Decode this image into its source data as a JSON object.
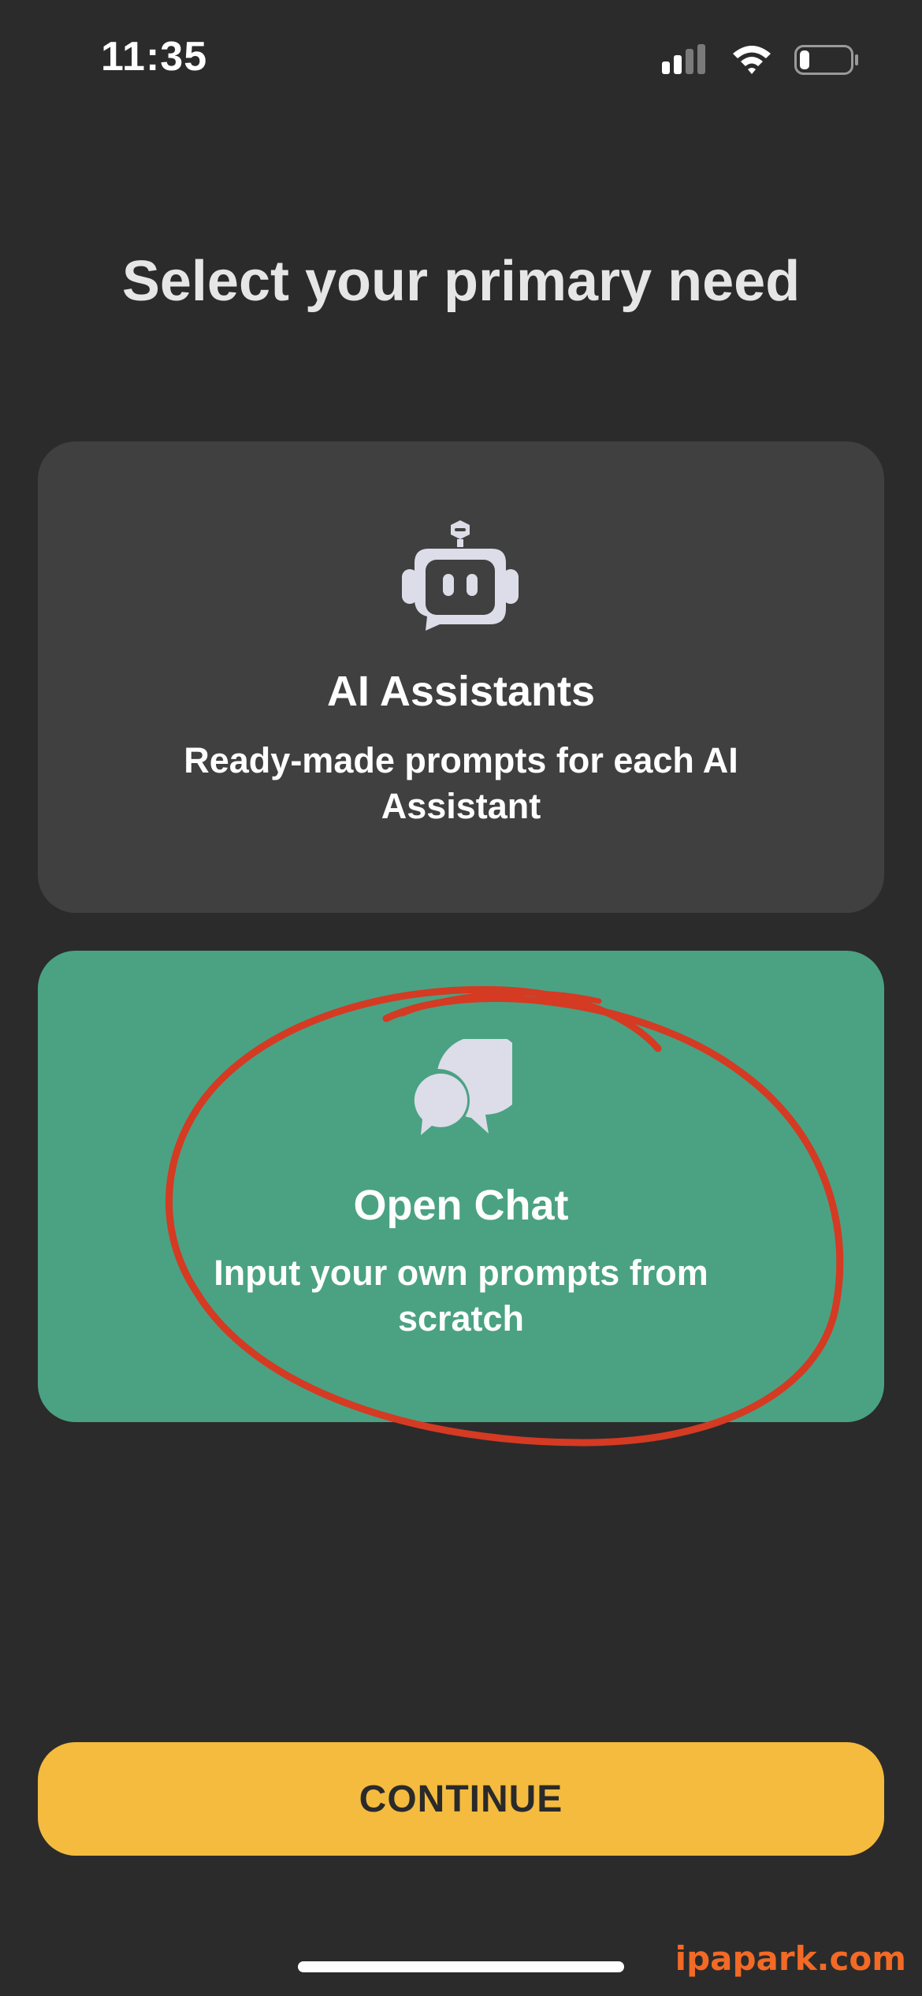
{
  "status_bar": {
    "time": "11:35",
    "icons": [
      "cellular-signal-icon",
      "wifi-icon",
      "battery-icon"
    ],
    "battery_level": 0.2
  },
  "title": "Select your primary need",
  "options": [
    {
      "icon": "robot-icon",
      "title": "AI Assistants",
      "description": "Ready-made prompts for each AI Assistant",
      "selected": false,
      "color": "#404040"
    },
    {
      "icon": "chat-bubbles-icon",
      "title": "Open Chat",
      "description": "Input your own prompts from scratch",
      "selected": true,
      "color": "#4aa283"
    }
  ],
  "continue_label": "CONTINUE",
  "continue_color": "#f4bb3e",
  "annotation_color": "#d53a23",
  "watermark": "ipapark.com"
}
